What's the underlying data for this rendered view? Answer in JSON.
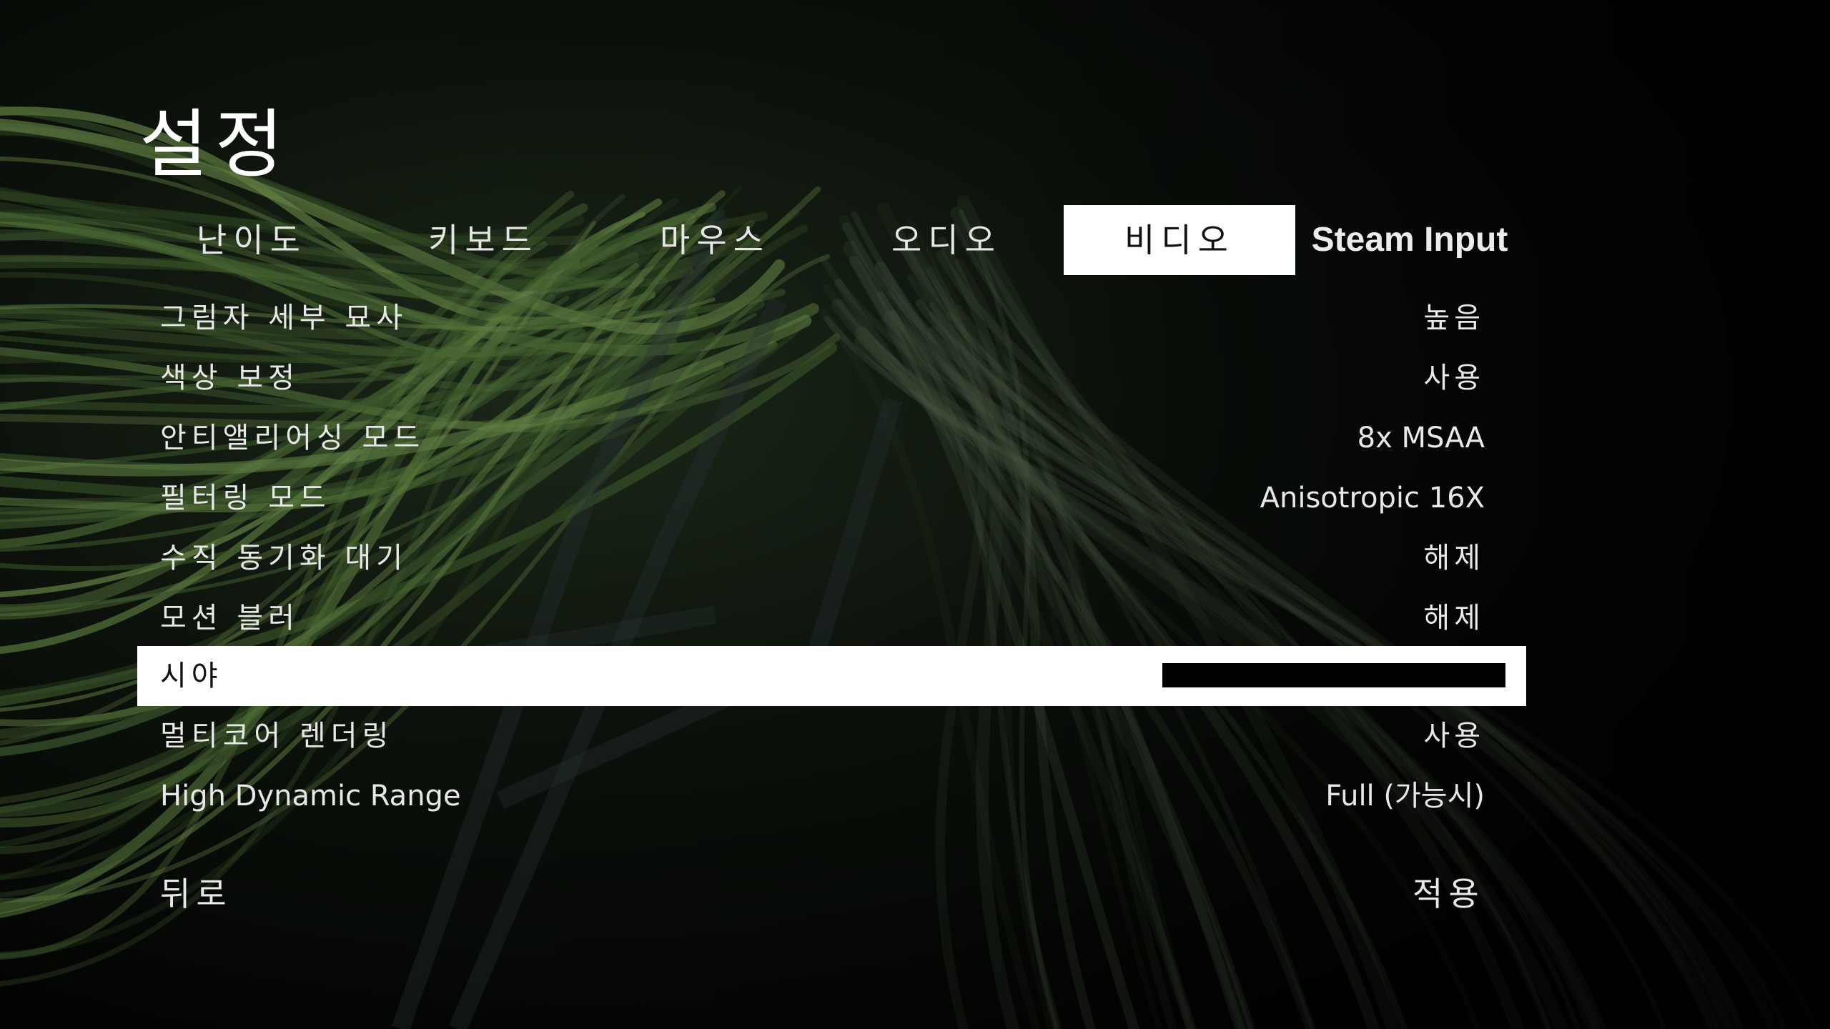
{
  "page": {
    "title": "설정"
  },
  "tabs": [
    {
      "label": "난이도",
      "active": false
    },
    {
      "label": "키보드",
      "active": false
    },
    {
      "label": "마우스",
      "active": false
    },
    {
      "label": "오디오",
      "active": false
    },
    {
      "label": "비디오",
      "active": true
    },
    {
      "label": "Steam Input",
      "active": false
    }
  ],
  "settings": [
    {
      "label": "그림자 세부 묘사",
      "value": "높음"
    },
    {
      "label": "색상 보정",
      "value": "사용"
    },
    {
      "label": "안티앨리어싱 모드",
      "value": "8x MSAA"
    },
    {
      "label": "필터링 모드",
      "value": "Anisotropic 16X"
    },
    {
      "label": "수직 동기화 대기",
      "value": "해제"
    },
    {
      "label": "모션 블러",
      "value": "해제"
    },
    {
      "label": "시야",
      "value": "120",
      "slider_fraction": 1.0
    },
    {
      "label": "멀티코어 렌더링",
      "value": "사용"
    },
    {
      "label": "High Dynamic Range",
      "value": "Full (가능시)"
    }
  ],
  "footer": {
    "back_label": "뒤로",
    "apply_label": "적용"
  },
  "colors": {
    "highlight_bg": "#ffffff",
    "highlight_text": "#111111",
    "text": "#e8e8e8",
    "background": "#000000",
    "cable_green": "#3f5a2c"
  }
}
